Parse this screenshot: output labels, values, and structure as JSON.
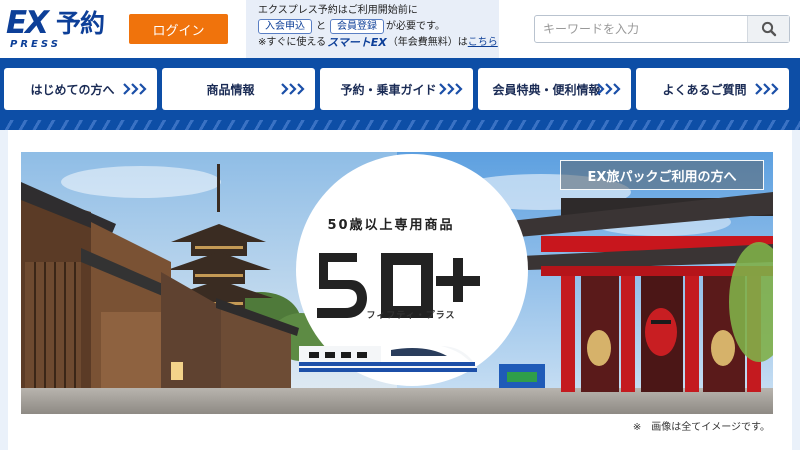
{
  "header": {
    "logo": {
      "ex": "EX",
      "yoyaku": "予約",
      "press": "PRESS"
    },
    "login_label": "ログイン",
    "notice": {
      "line1": "エクスプレス予約はご利用開始前に",
      "join_label": "入会申込",
      "and": "と",
      "member_label": "会員登録",
      "required": "が必要です。",
      "line3_prefix": "※すぐに使える",
      "smart_ex": "スマートEX",
      "line3_mid": "（年会費無料）は",
      "line3_link": "こちら"
    },
    "search": {
      "placeholder": "キーワードを入力",
      "icon": "search-icon"
    }
  },
  "nav": {
    "items": [
      {
        "label": "はじめての方へ"
      },
      {
        "label": "商品情報"
      },
      {
        "label": "予約・乗車ガイド"
      },
      {
        "label": "会員特典・便利情報"
      },
      {
        "label": "よくあるご質問"
      }
    ],
    "chevron_icon": "triple-chevron-icon"
  },
  "hero": {
    "ex_pack_label": "EX旅パックご利用の方へ",
    "circle_title": "50歳以上専用商品",
    "logo_text": "50+",
    "circle_sub": "フィフティ・プラス"
  },
  "footnote": "※　画像は全てイメージです。",
  "colors": {
    "brand_blue": "#0d4ea6",
    "login_orange": "#f0730c",
    "notice_bg": "#e8eef8"
  }
}
